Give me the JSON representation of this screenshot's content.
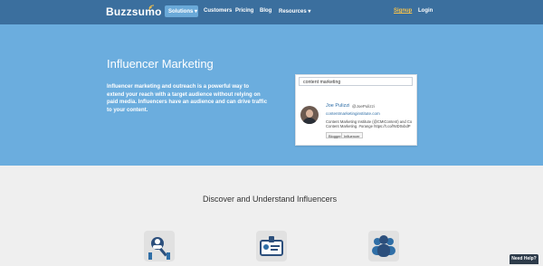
{
  "nav": {
    "logo": "Buzzsumo",
    "items": [
      "Solutions",
      "Customers",
      "Pricing",
      "Blog",
      "Resources"
    ],
    "signup": "Signup",
    "login": "Login"
  },
  "hero": {
    "title": "Influencer Marketing",
    "description": "Influencer marketing and outreach is a powerful way to extend your reach with a target audience without relying on paid media. Influencers have an audience and can drive traffic to your content.",
    "card": {
      "search_value": "content marketing",
      "name": "Joe Pulizzi",
      "handle": "@JoePulizzi",
      "site": "contentmarketinginstitute.com",
      "bio_line1": "Content Marketing Institute (@CMIContent) and Co",
      "bio_line2": "Content Marketing. #orange https://t.co/lNID0xbdP",
      "tags": [
        "Blogger",
        "Influencer"
      ]
    }
  },
  "features": {
    "title": "Discover and Understand Influencers",
    "icons": [
      "search-user-icon",
      "id-card-icon",
      "group-icon"
    ]
  },
  "help": {
    "label": "Need Help?"
  },
  "colors": {
    "nav": "#3b6f9e",
    "hero": "#6badde",
    "accent": "#f7c24a"
  }
}
